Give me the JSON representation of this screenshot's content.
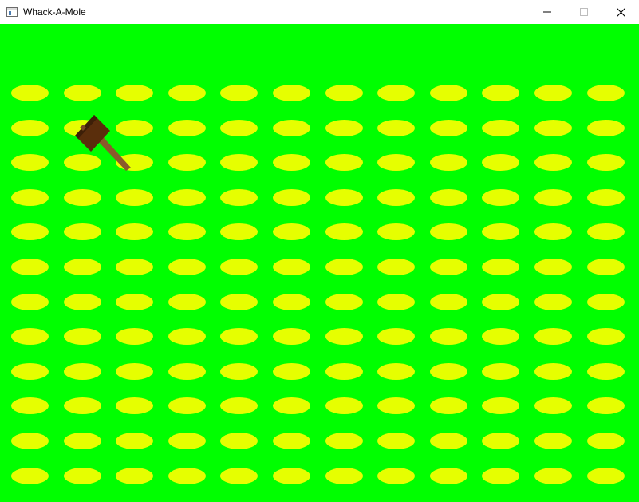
{
  "window": {
    "title": "Whack-A-Mole",
    "icon": "app-window-icon",
    "controls": [
      "minimize-icon",
      "maximize-icon",
      "close-icon"
    ]
  },
  "game": {
    "background_color": "#00ff00",
    "hole_color": "#e6ff00",
    "grid": {
      "rows": 12,
      "cols": 12
    },
    "cursor": "hammer-icon",
    "hammer_colors": {
      "head": "#5a2e0c",
      "handle": "#8a5a2b"
    }
  }
}
